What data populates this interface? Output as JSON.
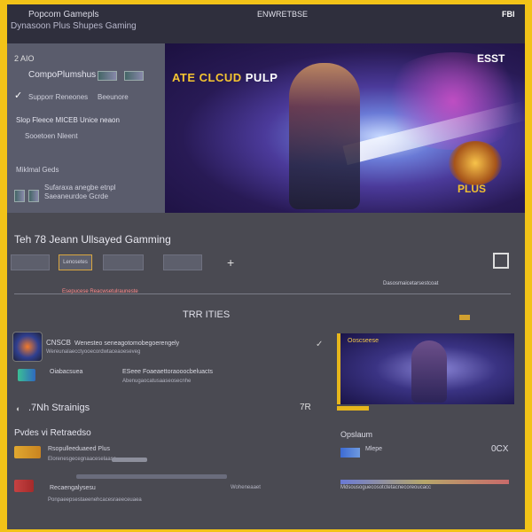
{
  "header": {
    "title": "Popcom Gamepls",
    "subtitle": "Dynasoon Plus  Shupes Gaming",
    "center_label": "ENWRETBSE",
    "right_label": "FBI"
  },
  "sidebar": {
    "number": "2 AIO",
    "items": [
      {
        "label": "CompoPlumshus"
      },
      {
        "label": "Supporr Reneones",
        "tag": "Beeunore"
      },
      {
        "label": "Slop Fleece  MICEB Unice neaon"
      },
      {
        "label": "Sooetoen Nleent"
      },
      {
        "label": "Miklmal Geds"
      },
      {
        "label": "Sufaraxa anegbe etnpl",
        "sub": "Saeaneurdoe Gcrde"
      }
    ]
  },
  "hero": {
    "logo_main": "ATE CLCUD ",
    "logo_accent": "PULP",
    "corner": "ESST",
    "badge": "PLUS"
  },
  "main": {
    "section_title": "Teh 78 Jeann Ullsayed Gamming",
    "categories": [
      "",
      "Lenosetes",
      "",
      ""
    ],
    "plus": "+",
    "info_red": "Esepucese Reacwsetulrauneste",
    "info_right": "Dasosmaicetarsestcoat",
    "mid_title": "TRR ITIES",
    "list": [
      {
        "title": "CNSCB",
        "desc": "Wenesteo seneagotomobegoerengely",
        "desc2": "Wereunalaecctyooecordwtaceaoeseveg"
      },
      {
        "title": "Oiabacsuea",
        "desc": "ESeee  Foaeaettoraooocbeluacts",
        "desc2": "Abenugaocatusaaseosecnhe"
      }
    ],
    "count_right": "✓",
    "promo_label": "Ooscseese",
    "stream_label": ".7Nh Strainigs",
    "stream_right": "7R",
    "sub_title": "Pvdes vi Retraedso",
    "rows": [
      {
        "title": "Rsopulleeduaeed Plus",
        "desc": "Elorenesgecegnaaceselaase"
      },
      {
        "title": "Recaengalysesu",
        "desc": "Ponpaeepsestaeenehcacesraeeceuaea"
      }
    ],
    "right_title": "Opslaum",
    "right_value": "0CX",
    "right_text": "Mlepe",
    "right_text2": "Woheneaaet",
    "right_foot": "Mdsousoguecosotctetacnecoreoucacc"
  }
}
